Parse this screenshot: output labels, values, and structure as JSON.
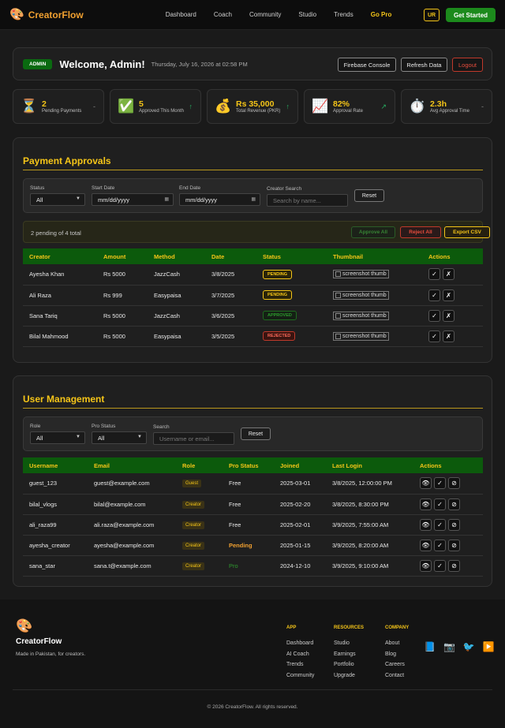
{
  "brand": {
    "name": "CreatorFlow",
    "icon": "palette-icon"
  },
  "nav": {
    "items": [
      "Dashboard",
      "Coach",
      "Community",
      "Studio",
      "Trends"
    ],
    "gopro": "Go Pro"
  },
  "header": {
    "lang": "UR",
    "get_started": "Get Started"
  },
  "welcome": {
    "badge": "ADMIN",
    "title": "Welcome, Admin!",
    "date": "Thursday, July 16, 2026 at 02:58 PM",
    "buttons": {
      "firebase": "Firebase Console",
      "refresh": "Refresh Data",
      "logout": "Logout"
    }
  },
  "stats": [
    {
      "icon": "⏳",
      "value": "2",
      "label": "Pending Payments",
      "arrow": "-"
    },
    {
      "icon": "✅",
      "value": "5",
      "label": "Approved This Month",
      "arrow": "↑"
    },
    {
      "icon": "💰",
      "value": "Rs 35,000",
      "label": "Total Revenue (PKR)",
      "arrow": "↑"
    },
    {
      "icon": "📈",
      "value": "82%",
      "label": "Approval Rate",
      "arrow": "↗"
    },
    {
      "icon": "⏱️",
      "value": "2.3h",
      "label": "Avg Approval Time",
      "arrow": "-"
    }
  ],
  "payments": {
    "title": "Payment Approvals",
    "filters": {
      "status_label": "Status",
      "status_value": "All",
      "start_label": "Start Date",
      "start_placeholder": "mm/dd/yyyy",
      "end_label": "End Date",
      "end_placeholder": "mm/dd/yyyy",
      "search_label": "Creator Search",
      "search_placeholder": "Search by name...",
      "reset": "Reset"
    },
    "bulk": {
      "summary": "2 pending of 4 total",
      "approve_all": "Approve All",
      "reject_all": "Reject All",
      "export": "Export CSV"
    },
    "columns": [
      "Creator",
      "Amount",
      "Method",
      "Date",
      "Status",
      "Thumbnail",
      "Actions"
    ],
    "rows": [
      {
        "creator": "Ayesha Khan",
        "amount": "Rs 5000",
        "method": "JazzCash",
        "date": "3/8/2025",
        "status": "PENDING",
        "status_kind": "pending",
        "thumb": "screenshot thumb"
      },
      {
        "creator": "Ali Raza",
        "amount": "Rs 999",
        "method": "Easypaisa",
        "date": "3/7/2025",
        "status": "PENDING",
        "status_kind": "pending",
        "thumb": "screenshot thumb"
      },
      {
        "creator": "Sana Tariq",
        "amount": "Rs 5000",
        "method": "JazzCash",
        "date": "3/6/2025",
        "status": "APPROVED",
        "status_kind": "approved",
        "thumb": "screenshot thumb"
      },
      {
        "creator": "Bilal Mahmood",
        "amount": "Rs 5000",
        "method": "Easypaisa",
        "date": "3/5/2025",
        "status": "REJECTED",
        "status_kind": "rejected",
        "thumb": "screenshot thumb"
      }
    ],
    "actions": {
      "approve": "✓",
      "reject": "✗"
    }
  },
  "users": {
    "title": "User Management",
    "filters": {
      "role_label": "Role",
      "role_value": "All",
      "pro_label": "Pro Status",
      "pro_value": "All",
      "search_label": "Search",
      "search_placeholder": "Username or email...",
      "reset": "Reset"
    },
    "columns": [
      "Username",
      "Email",
      "Role",
      "Pro Status",
      "Joined",
      "Last Login",
      "Actions"
    ],
    "rows": [
      {
        "username": "guest_123",
        "email": "guest@example.com",
        "role": "Guest",
        "pro": "Free",
        "pro_kind": "free",
        "joined": "2025-03-01",
        "last_login": "3/8/2025, 12:00:00 PM"
      },
      {
        "username": "bilal_vlogs",
        "email": "bilal@example.com",
        "role": "Creator",
        "pro": "Free",
        "pro_kind": "free",
        "joined": "2025-02-20",
        "last_login": "3/8/2025, 8:30:00 PM"
      },
      {
        "username": "ali_raza99",
        "email": "ali.raza@example.com",
        "role": "Creator",
        "pro": "Free",
        "pro_kind": "free",
        "joined": "2025-02-01",
        "last_login": "3/9/2025, 7:55:00 AM"
      },
      {
        "username": "ayesha_creator",
        "email": "ayesha@example.com",
        "role": "Creator",
        "pro": "Pending",
        "pro_kind": "pending",
        "joined": "2025-01-15",
        "last_login": "3/9/2025, 8:20:00 AM"
      },
      {
        "username": "sana_star",
        "email": "sana.t@example.com",
        "role": "Creator",
        "pro": "Pro",
        "pro_kind": "pro",
        "joined": "2024-12-10",
        "last_login": "3/9/2025, 9:10:00 AM"
      }
    ],
    "actions": {
      "view": "👁",
      "check": "✓",
      "ban": "⊘"
    }
  },
  "footer": {
    "name": "CreatorFlow",
    "tagline": "Made in Pakistan, for creators.",
    "columns": [
      {
        "heading": "APP",
        "items": [
          "Dashboard",
          "AI Coach",
          "Trends",
          "Community"
        ]
      },
      {
        "heading": "RESOURCES",
        "items": [
          "Studio",
          "Earnings",
          "Portfolio",
          "Upgrade"
        ]
      },
      {
        "heading": "COMPANY",
        "items": [
          "About",
          "Blog",
          "Careers",
          "Contact"
        ]
      }
    ],
    "socials": [
      "📘",
      "📷",
      "🐦",
      "▶️"
    ],
    "copyright": "© 2026 CreatorFlow. All rights reserved."
  }
}
